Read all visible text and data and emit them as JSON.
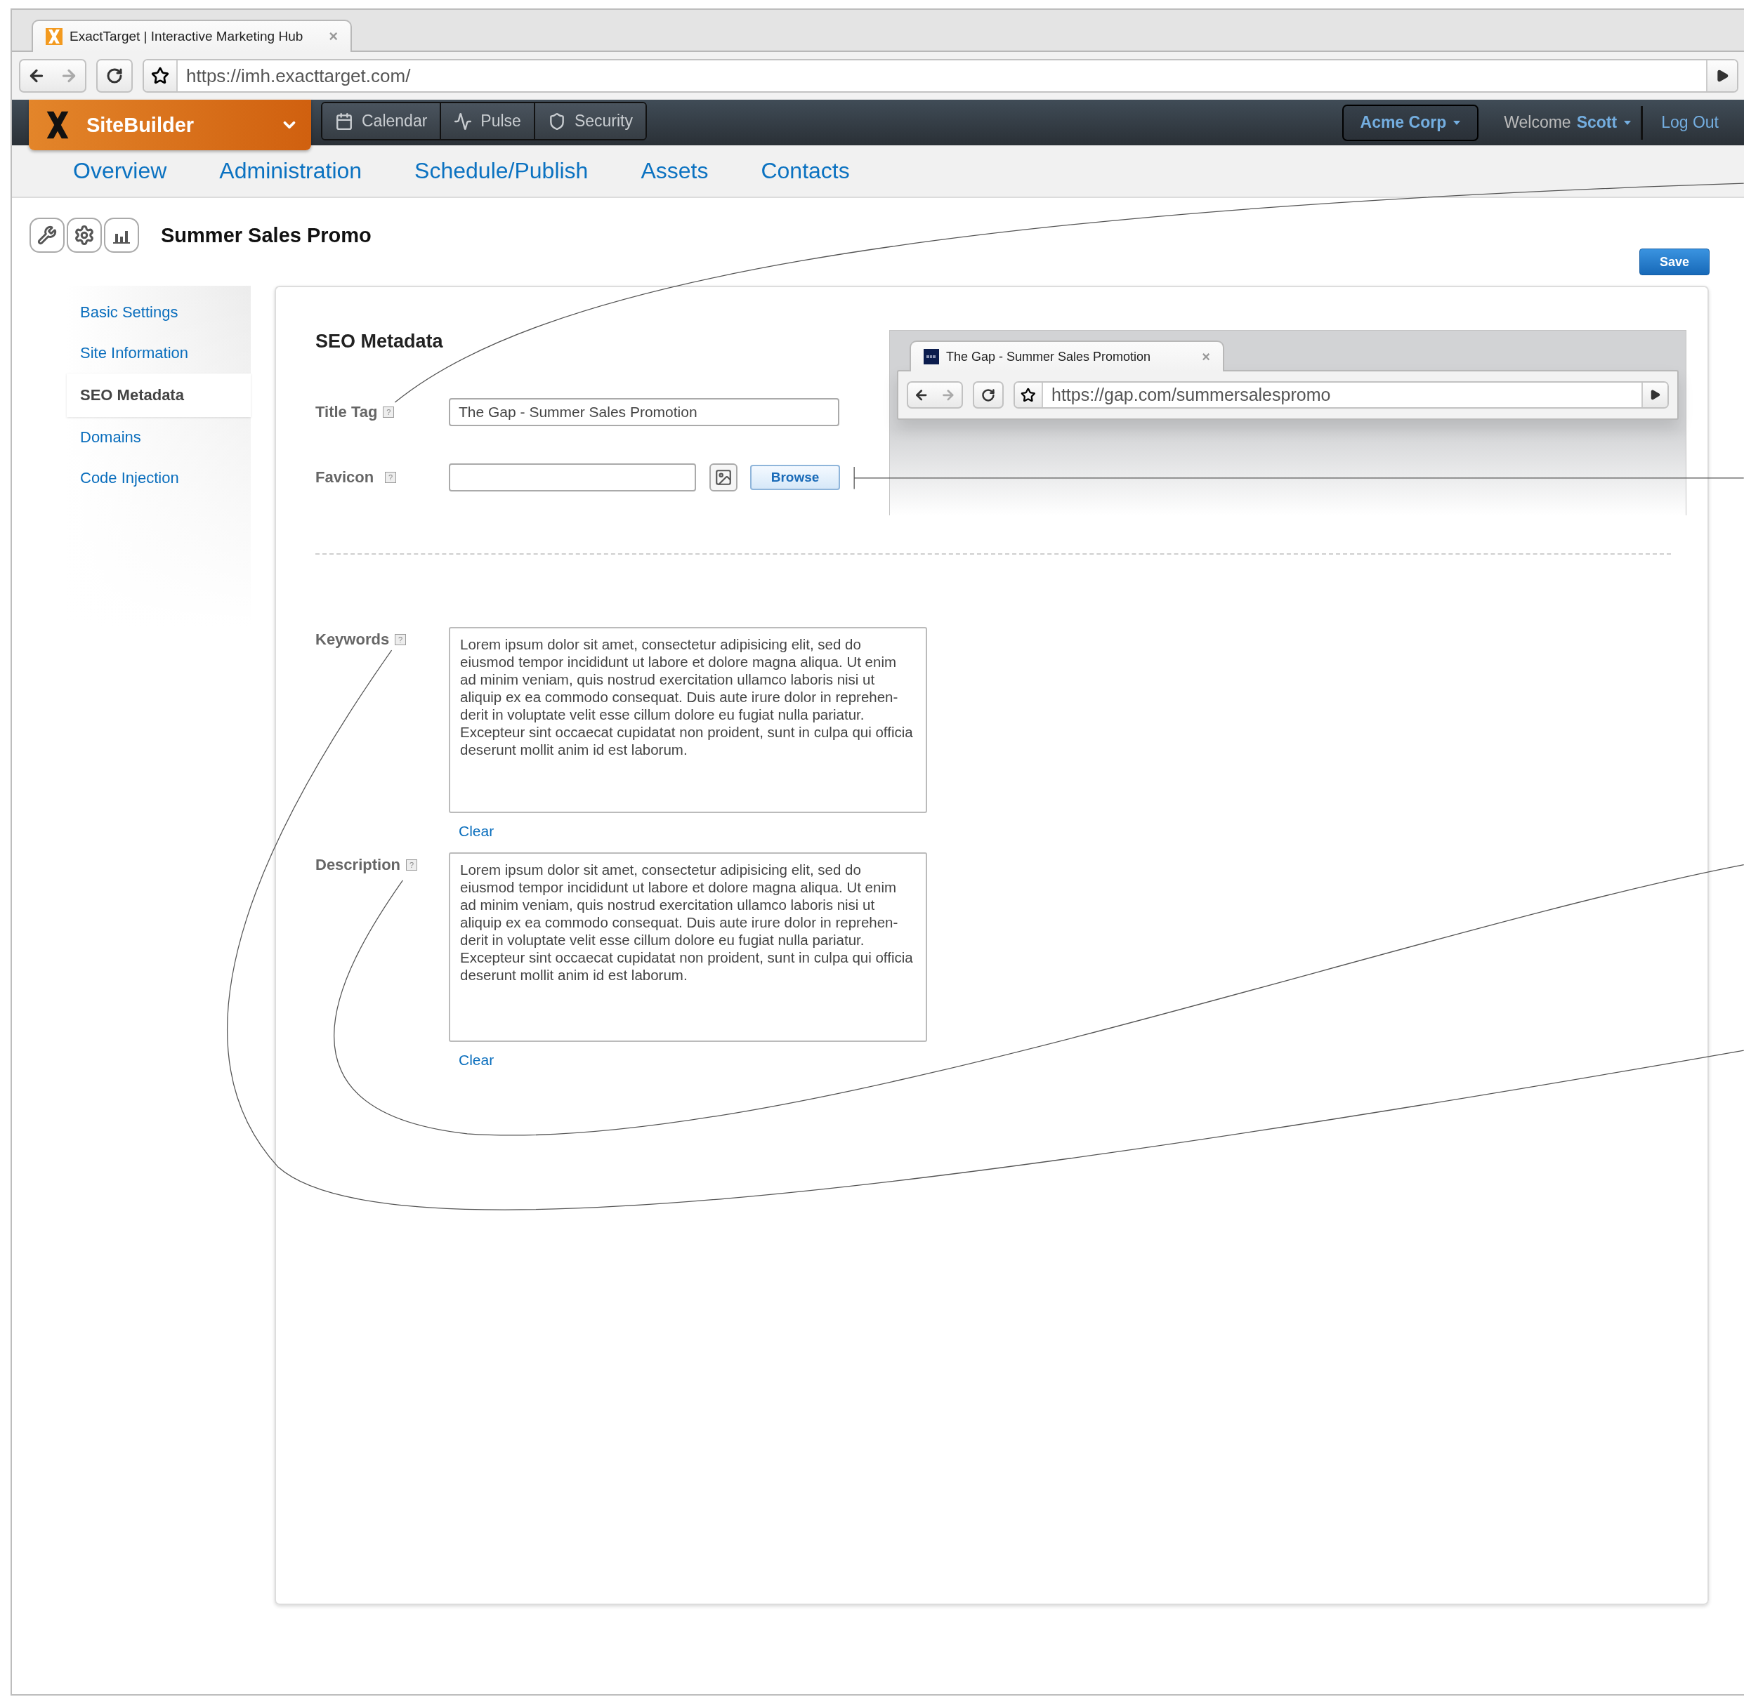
{
  "browser": {
    "tab_title": "ExactTarget | Interactive Marketing Hub",
    "tab_close": "×",
    "url": "https://imh.exacttarget.com/"
  },
  "app_bar": {
    "product": "SiteBuilder",
    "tools": [
      "Calendar",
      "Pulse",
      "Security"
    ],
    "account": "Acme Corp",
    "welcome": "Welcome",
    "user": "Scott",
    "logout": "Log Out"
  },
  "nav": [
    "Overview",
    "Administration",
    "Schedule/Publish",
    "Assets",
    "Contacts"
  ],
  "page": {
    "title": "Summer Sales Promo",
    "save": "Save"
  },
  "sidebar": [
    {
      "label": "Basic Settings",
      "selected": false
    },
    {
      "label": "Site Information",
      "selected": false
    },
    {
      "label": "SEO Metadata",
      "selected": true
    },
    {
      "label": "Domains",
      "selected": false
    },
    {
      "label": "Code Injection",
      "selected": false
    }
  ],
  "section_title": "SEO Metadata",
  "title_tag": {
    "label": "Title Tag",
    "help": "?",
    "value": "The Gap - Summer Sales Promotion"
  },
  "favicon": {
    "label": "Favicon",
    "help": "?",
    "browse": "Browse"
  },
  "text_fields": [
    {
      "label": "Keywords",
      "help": "?",
      "value": "Lorem ipsum dolor sit amet, consectetur adipisicing elit, sed do eiusmod tempor incididunt ut labore et dolore magna aliqua. Ut enim ad minim veniam, quis nostrud exercitation ullamco laboris nisi ut aliquip ex ea commodo consequat. Duis aute irure dolor in reprehen-derit in voluptate velit esse cillum dolore eu fugiat nulla pariatur. Excepteur sint occaecat cupidatat non proident, sunt in culpa qui officia deserunt mollit anim id est laborum.",
      "clear": "Clear"
    },
    {
      "label": "Description",
      "help": "?",
      "value": "Lorem ipsum dolor sit amet, consectetur adipisicing elit, sed do eiusmod tempor incididunt ut labore et dolore magna aliqua. Ut enim ad minim veniam, quis nostrud exercitation ullamco laboris nisi ut aliquip ex ea commodo consequat. Duis aute irure dolor in reprehen-derit in voluptate velit esse cillum dolore eu fugiat nulla pariatur. Excepteur sint occaecat cupidatat non proident, sunt in culpa qui officia deserunt mollit anim id est laborum.",
      "clear": "Clear"
    }
  ],
  "preview": {
    "tab_title": "The Gap - Summer Sales Promotion",
    "tab_close": "×",
    "url": "https://gap.com/summersalespromo"
  }
}
